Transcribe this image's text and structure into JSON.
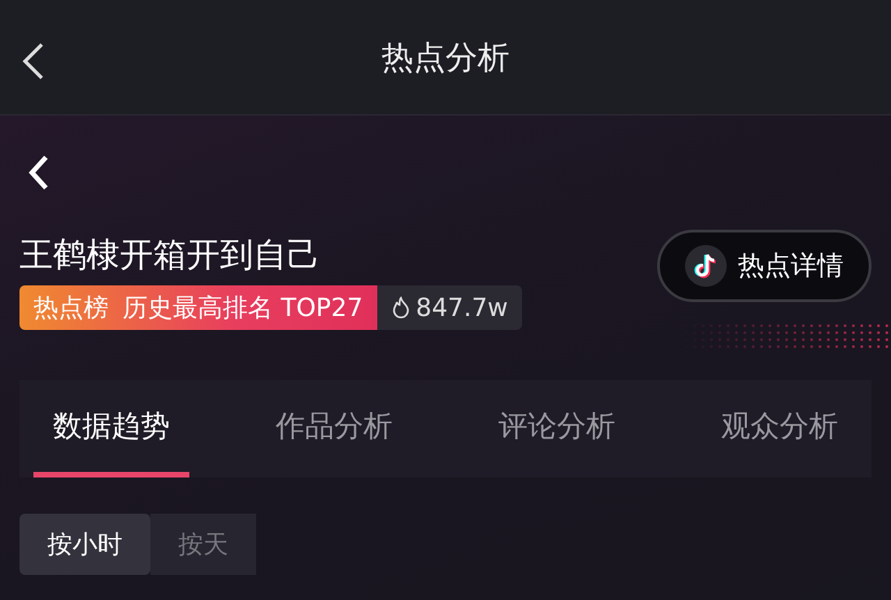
{
  "header": {
    "title": "热点分析"
  },
  "topic": {
    "title": "王鹤棣开箱开到自己",
    "detail_button": "热点详情",
    "rank_label": "热点榜",
    "rank_text": "历史最高排名 TOP27",
    "heat": "847.7w"
  },
  "tabs": [
    {
      "label": "数据趋势",
      "selected": true
    },
    {
      "label": "作品分析",
      "selected": false
    },
    {
      "label": "评论分析",
      "selected": false
    },
    {
      "label": "观众分析",
      "selected": false
    }
  ],
  "granularity": [
    {
      "label": "按小时",
      "selected": true
    },
    {
      "label": "按天",
      "selected": false
    }
  ]
}
